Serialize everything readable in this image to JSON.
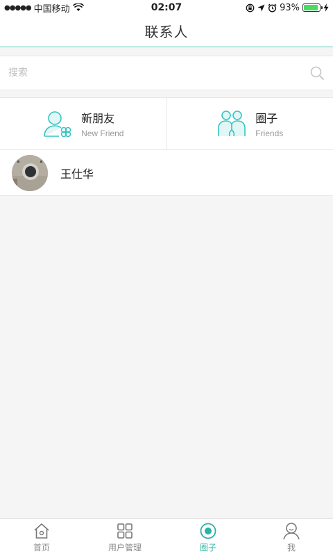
{
  "status_bar": {
    "carrier": "中国移动",
    "time": "02:07",
    "battery": "93%",
    "battery_level": 0.93
  },
  "nav": {
    "title": "联系人"
  },
  "search": {
    "placeholder": "搜索"
  },
  "quick_links": [
    {
      "title": "新朋友",
      "subtitle": "New Friend",
      "icon": "new-friend-icon"
    },
    {
      "title": "圈子",
      "subtitle": "Friends",
      "icon": "friends-icon"
    }
  ],
  "contacts": [
    {
      "name": "王仕华",
      "avatar": "avatar-photo"
    }
  ],
  "tabs": [
    {
      "label": "首页",
      "icon": "home-icon",
      "active": false
    },
    {
      "label": "用户管理",
      "icon": "grid-icon",
      "active": false
    },
    {
      "label": "圈子",
      "icon": "circle-icon",
      "active": true
    },
    {
      "label": "我",
      "icon": "profile-icon",
      "active": false
    }
  ],
  "colors": {
    "accent": "#2bb3a6",
    "icon_teal": "#35c5c2",
    "battery_green": "#4cd964"
  }
}
